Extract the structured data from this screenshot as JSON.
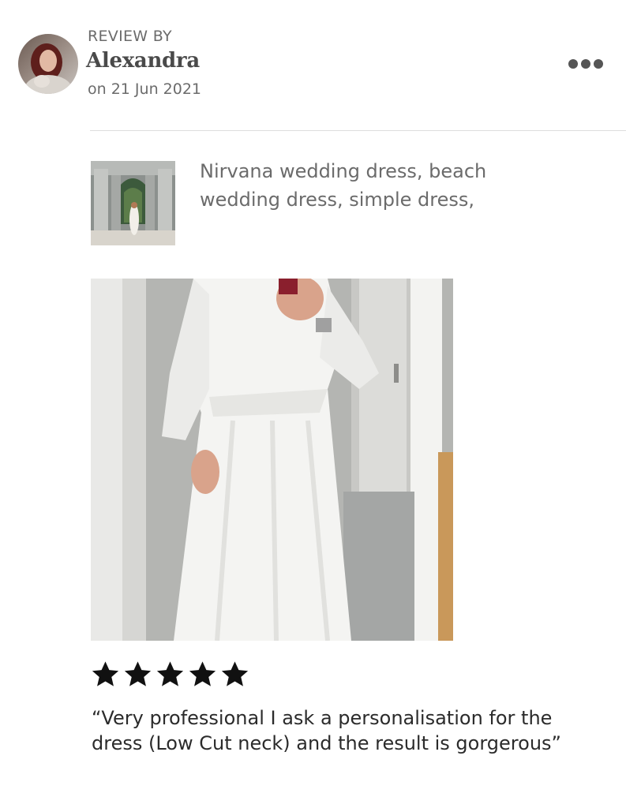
{
  "header": {
    "review_by_label": "REVIEW BY",
    "reviewer_name": "Alexandra",
    "date": "on 21 Jun 2021",
    "more_icon": "more-horizontal-icon"
  },
  "listing": {
    "title": "Nirvana wedding dress, beach wedding dress, simple dress,"
  },
  "review": {
    "rating": 5,
    "rating_max": 5,
    "text": "“Very professional I ask a personalisation for the dress (Low Cut neck) and the result is gorgerous”"
  },
  "colors": {
    "primary_text": "#222222",
    "secondary_text": "#6b6b6b",
    "star": "#111111",
    "divider": "#dedede"
  }
}
